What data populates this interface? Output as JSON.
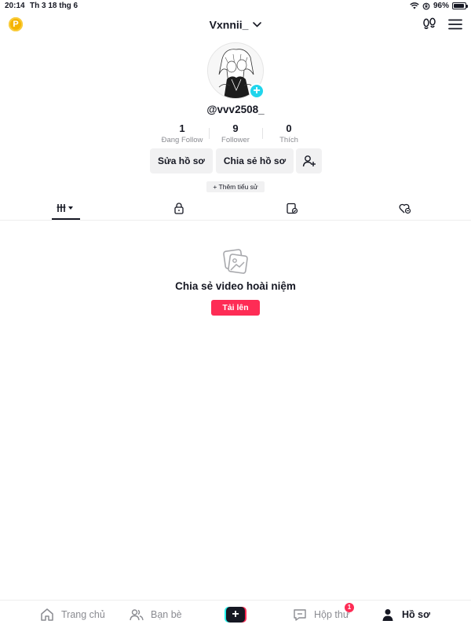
{
  "status_bar": {
    "time": "20:14",
    "date": "Th 3 18 thg 6",
    "battery": "96%",
    "battery_level": 0.96
  },
  "header": {
    "username": "Vxnnii_",
    "coin_label": "P"
  },
  "profile": {
    "handle": "@vvv2508_",
    "stats": [
      {
        "value": "1",
        "label": "Đang Follow"
      },
      {
        "value": "9",
        "label": "Follower"
      },
      {
        "value": "0",
        "label": "Thích"
      }
    ],
    "edit_button": "Sửa hồ sơ",
    "share_button": "Chia sẻ hồ sơ",
    "bio_button": "+ Thêm tiểu sử"
  },
  "empty_state": {
    "title": "Chia sẻ video hoài niệm",
    "upload_button": "Tải lên"
  },
  "bottom_nav": {
    "home": "Trang chủ",
    "friends": "Bạn bè",
    "inbox": "Hộp thư",
    "inbox_badge": "1",
    "profile": "Hồ sơ"
  },
  "colors": {
    "accent": "#fe2c55",
    "avatar_add": "#20d5ec",
    "coin": "#f5b400"
  }
}
